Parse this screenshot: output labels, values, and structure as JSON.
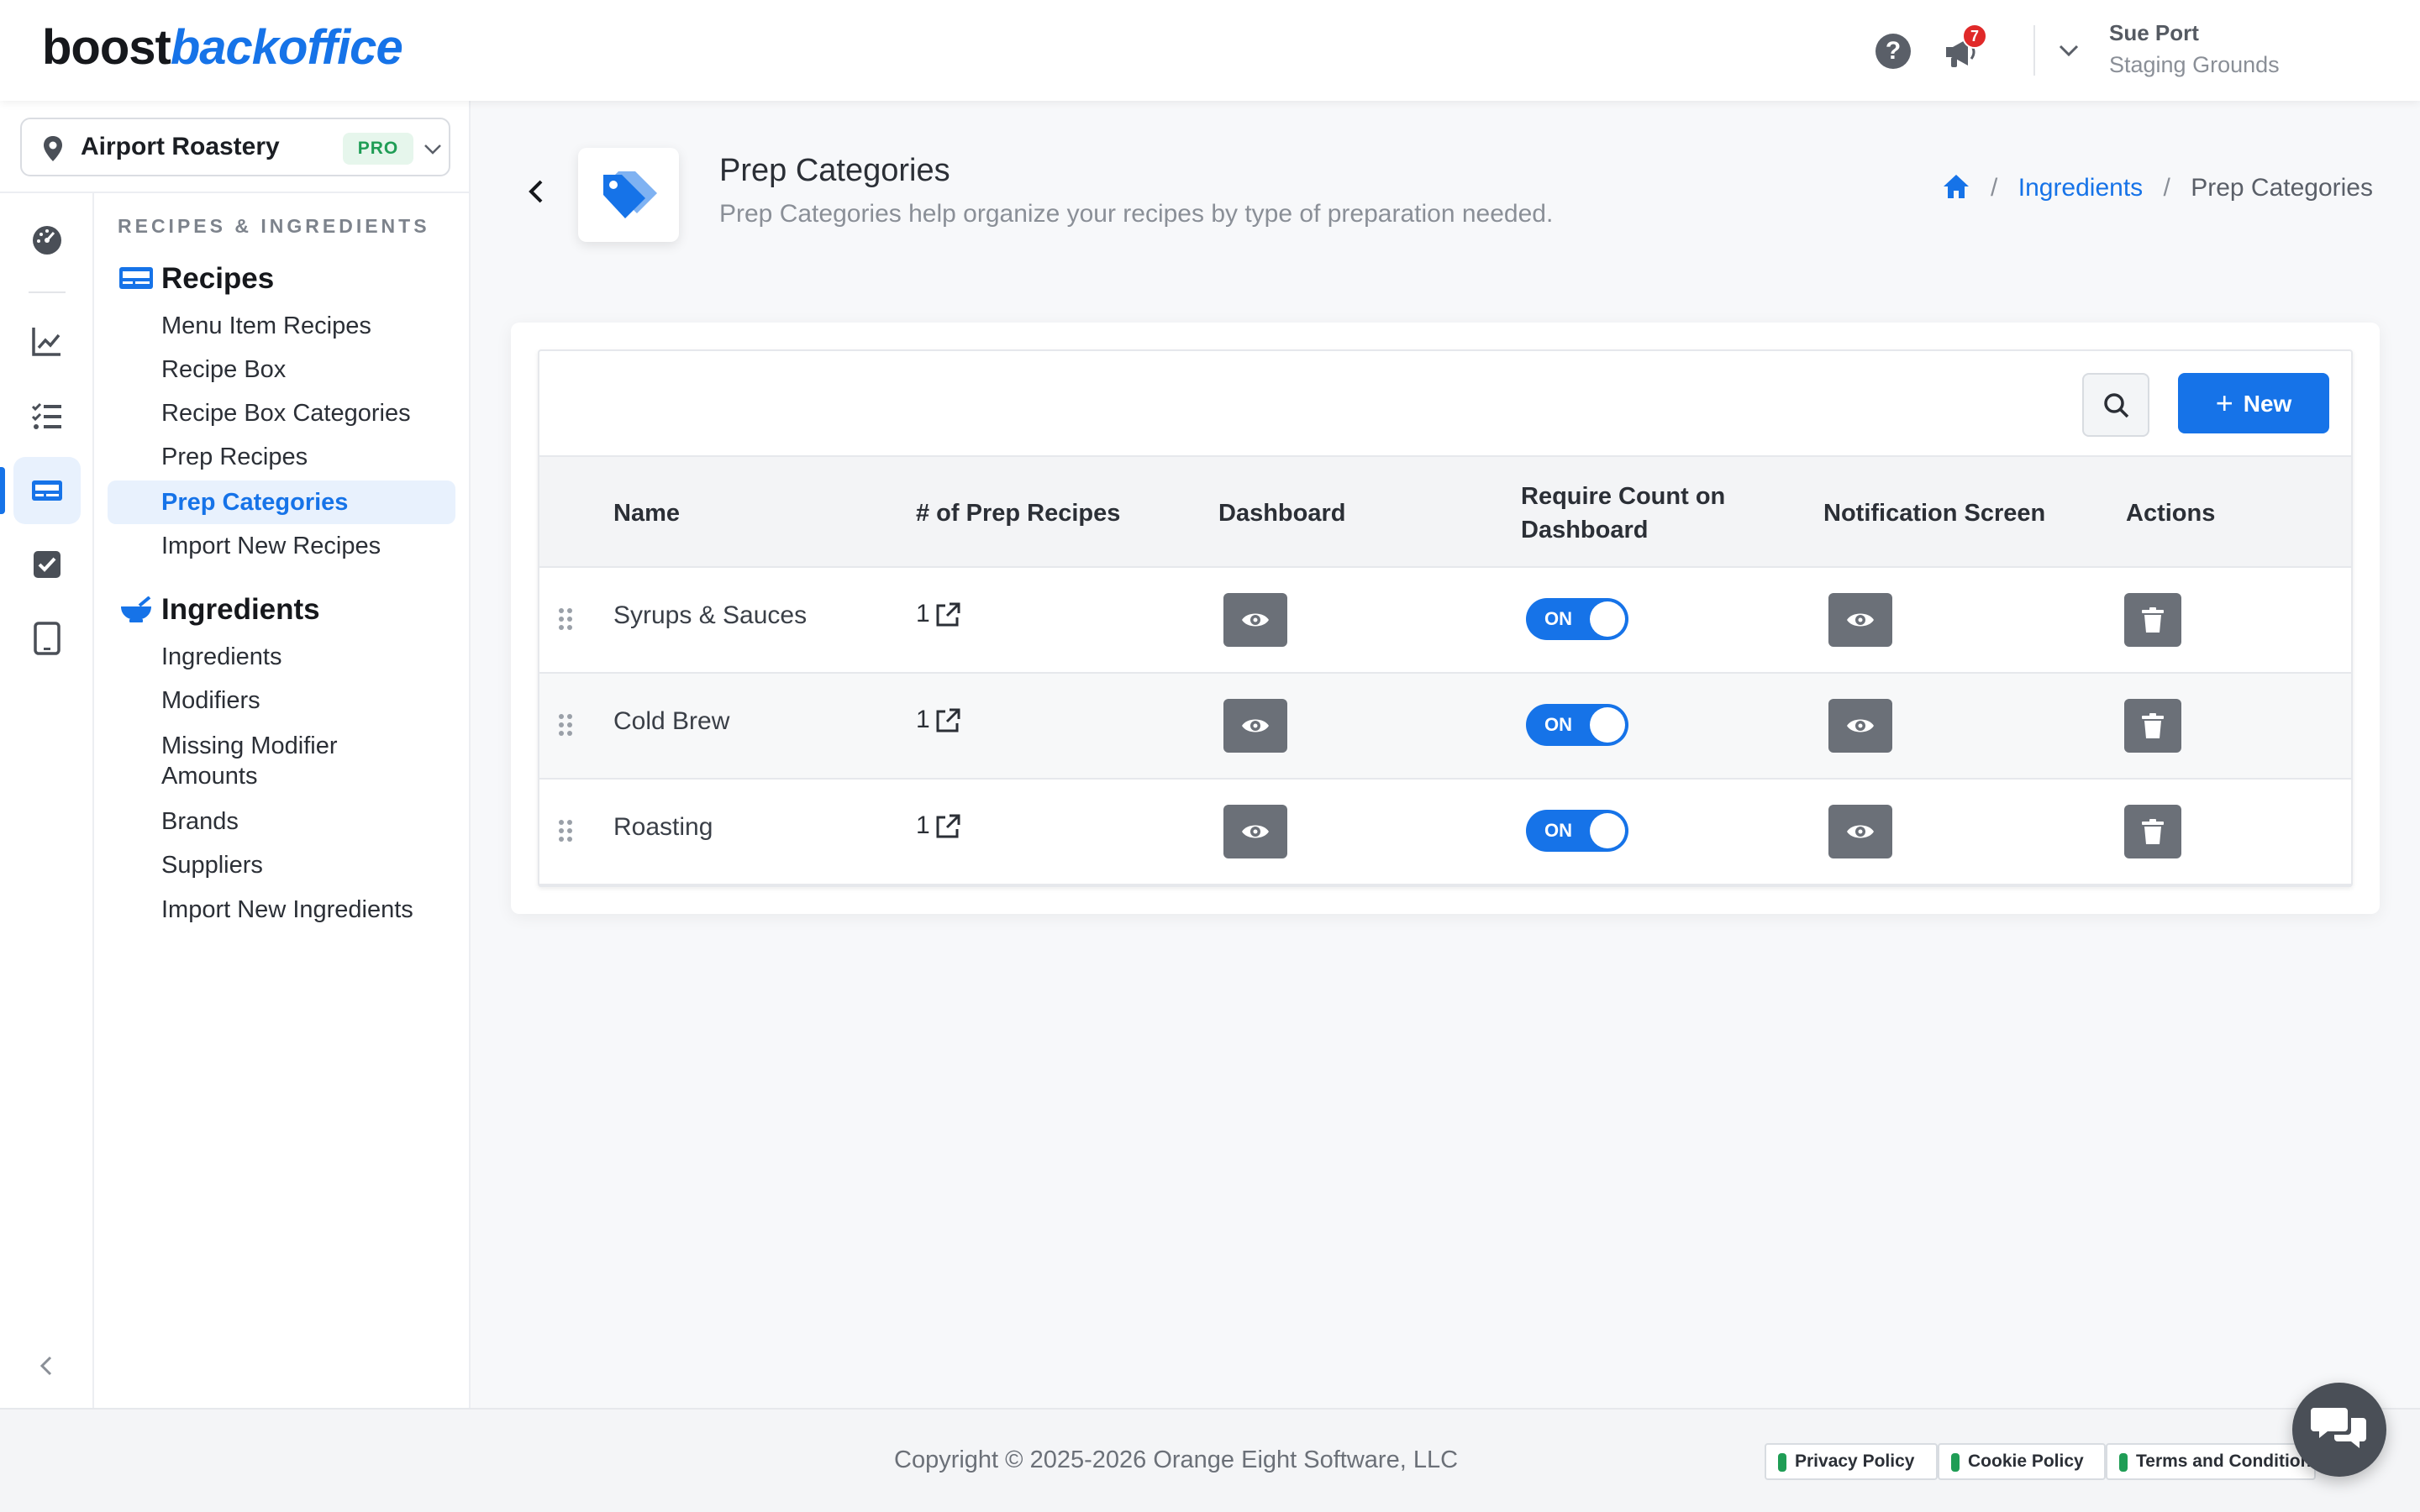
{
  "header": {
    "logo_part1": "boost",
    "logo_part2": "backoffice",
    "help_icon": "question-circle-icon",
    "notifications_icon": "megaphone-icon",
    "notification_count": "7",
    "user_name": "Sue Port",
    "user_org": "Staging Grounds"
  },
  "location": {
    "name": "Airport Roastery",
    "plan_badge": "PRO"
  },
  "rail": {
    "items": [
      "dashboard-gauge-icon",
      "chart-line-icon",
      "checklist-icon",
      "recipes-card-icon",
      "checkbox-icon",
      "tablet-icon"
    ],
    "active": "recipes-card-icon"
  },
  "subnav": {
    "section_label": "RECIPES & INGREDIENTS",
    "groups": [
      {
        "title": "Recipes",
        "items": [
          "Menu Item Recipes",
          "Recipe Box",
          "Recipe Box Categories",
          "Prep Recipes",
          "Prep Categories",
          "Import New Recipes"
        ]
      },
      {
        "title": "Ingredients",
        "items": [
          "Ingredients",
          "Modifiers",
          "Missing Modifier Amounts",
          "Brands",
          "Suppliers",
          "Import New Ingredients"
        ]
      }
    ],
    "active_item": "Prep Categories"
  },
  "page": {
    "title": "Prep Categories",
    "subtitle": "Prep Categories help organize your recipes by type of preparation needed.",
    "breadcrumb": [
      "Ingredients",
      "Prep Categories"
    ]
  },
  "toolbar": {
    "new_label": "New"
  },
  "table": {
    "columns": [
      "Name",
      "# of Prep Recipes",
      "Dashboard",
      "Require Count on Dashboard",
      "Notification Screen",
      "Actions"
    ],
    "rows": [
      {
        "name": "Syrups & Sauces",
        "count": "1",
        "require_count": "ON"
      },
      {
        "name": "Cold Brew",
        "count": "1",
        "require_count": "ON"
      },
      {
        "name": "Roasting",
        "count": "1",
        "require_count": "ON"
      }
    ]
  },
  "footer": {
    "copyright": "Copyright © 2025-2026 Orange Eight Software, LLC",
    "links": [
      "Privacy Policy",
      "Cookie Policy",
      "Terms and Conditions"
    ]
  },
  "colors": {
    "accent": "#1673e8",
    "button_gray": "#6b7078",
    "pro_green": "#1f9d55",
    "badge_red": "#e02929"
  }
}
